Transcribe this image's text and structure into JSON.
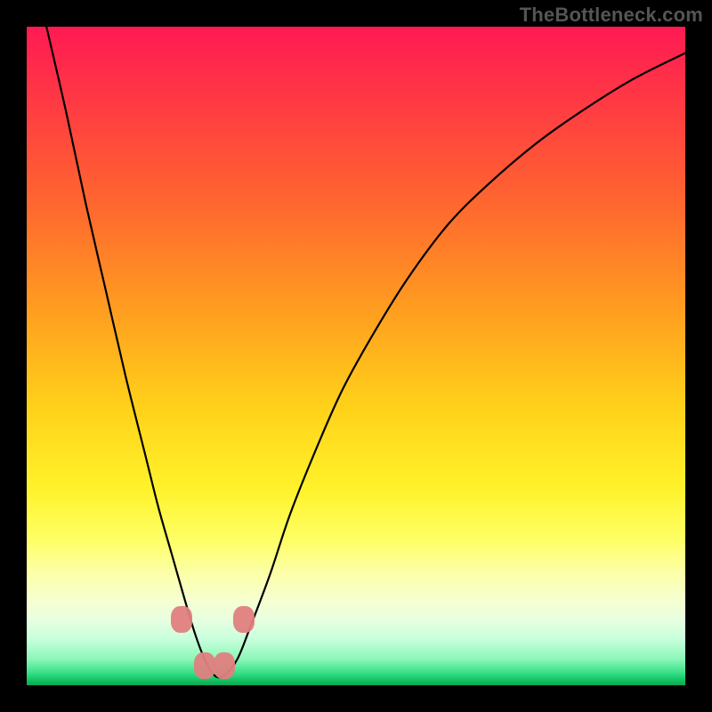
{
  "attribution": "TheBottleneck.com",
  "chart_data": {
    "type": "line",
    "title": "",
    "xlabel": "",
    "ylabel": "",
    "xlim": [
      0,
      100
    ],
    "ylim": [
      0,
      100
    ],
    "grid": false,
    "series": [
      {
        "name": "bottleneck-curve",
        "x": [
          3,
          6,
          9,
          12,
          15,
          18,
          20,
          22,
          24,
          25.5,
          27,
          28.5,
          30,
          32,
          34,
          37,
          40,
          44,
          48,
          53,
          58,
          64,
          70,
          77,
          84,
          92,
          100
        ],
        "values": [
          100,
          87,
          73,
          60,
          47,
          35,
          27,
          20,
          13,
          8,
          4,
          1.5,
          1.5,
          4,
          9,
          17,
          26,
          36,
          45,
          54,
          62,
          70,
          76,
          82,
          87,
          92,
          96
        ]
      }
    ],
    "optimal_region": {
      "x_start": 24,
      "x_end": 34,
      "y_max": 12
    },
    "markers": [
      {
        "x": 23.5,
        "y": 10
      },
      {
        "x": 27,
        "y": 3
      },
      {
        "x": 30,
        "y": 3
      },
      {
        "x": 33,
        "y": 10
      }
    ]
  }
}
